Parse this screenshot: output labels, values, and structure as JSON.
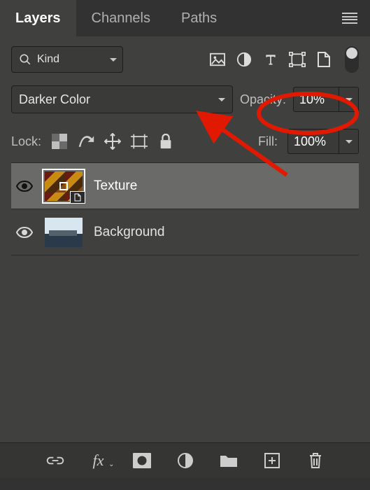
{
  "tabs": {
    "layers": "Layers",
    "channels": "Channels",
    "paths": "Paths"
  },
  "filter": {
    "kind": "Kind"
  },
  "blend": {
    "mode": "Darker Color"
  },
  "opacity": {
    "label": "Opacity:",
    "value": "10%"
  },
  "lock": {
    "label": "Lock:"
  },
  "fill": {
    "label": "Fill:",
    "value": "100%"
  },
  "layers_list": [
    {
      "name": "Texture"
    },
    {
      "name": "Background"
    }
  ],
  "icons": {
    "search": "search-icon",
    "image": "image-icon",
    "adjust": "adjustment-icon",
    "type": "type-icon",
    "shape": "shape-icon",
    "artboard": "artboard-icon",
    "smartobj": "smart-object-icon"
  }
}
